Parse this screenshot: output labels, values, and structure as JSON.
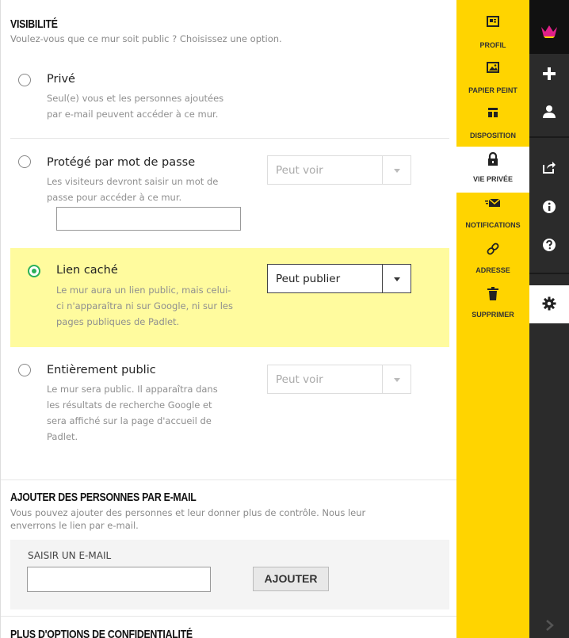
{
  "visibility": {
    "title": "VISIBILITÉ",
    "subtitle": "Voulez-vous que ce mur soit public ? Choisissez une option.",
    "options": [
      {
        "label": "Privé",
        "desc": [
          "Seul(e) vous et les personnes ajoutées",
          "par e-mail peuvent accéder à ce mur."
        ],
        "selected": false
      },
      {
        "label": "Protégé par mot de passe",
        "desc": [
          "Les visiteurs devront saisir un mot de",
          "passe pour accéder à ce mur."
        ],
        "selected": false,
        "permission": "Peut voir",
        "password_value": ""
      },
      {
        "label": "Lien caché",
        "desc": [
          "Le mur aura un lien public, mais celui-",
          "ci n'apparaîtra ni sur Google, ni sur les",
          "pages publiques de Padlet."
        ],
        "selected": true,
        "permission": "Peut publier"
      },
      {
        "label": "Entièrement public",
        "desc": [
          "Le mur sera public. Il apparaîtra dans",
          "les résultats de recherche Google et",
          "sera affiché sur la page d'accueil de",
          "Padlet."
        ],
        "selected": false,
        "permission": "Peut voir"
      }
    ]
  },
  "add_people": {
    "title": "AJOUTER DES PERSONNES PAR E-MAIL",
    "subtitle": [
      "Vous pouvez ajouter des personnes et leur donner plus de contrôle. Nous leur",
      "enverrons le lien par e-mail."
    ],
    "email_label": "SAISIR UN E-MAIL",
    "email_value": "",
    "add_button": "AJOUTER"
  },
  "more_options": {
    "title": "PLUS D'OPTIONS DE CONFIDENTIALITÉ"
  },
  "nav": {
    "items": [
      {
        "label": "PROFIL",
        "icon": "profile-card-icon"
      },
      {
        "label": "PAPIER PEINT",
        "icon": "wallpaper-icon"
      },
      {
        "label": "DISPOSITION",
        "icon": "layout-icon"
      },
      {
        "label": "VIE PRIVÉE",
        "icon": "lock-icon",
        "active": true
      },
      {
        "label": "NOTIFICATIONS",
        "icon": "mail-icon"
      },
      {
        "label": "ADRESSE",
        "icon": "link-icon"
      },
      {
        "label": "SUPPRIMER",
        "icon": "trash-icon"
      }
    ]
  },
  "rail": {
    "items": [
      "padlet-logo-icon",
      "plus-icon",
      "user-icon",
      "share-icon",
      "info-icon",
      "help-icon",
      "gear-icon",
      "chevron-right-icon"
    ]
  },
  "colors": {
    "nav_yellow": "#ffd400",
    "selected_bg": "#fffb9e",
    "radio_green": "#2bb05a",
    "rail_dark": "#2b2b2b",
    "logo_pink": "#e0218a"
  }
}
